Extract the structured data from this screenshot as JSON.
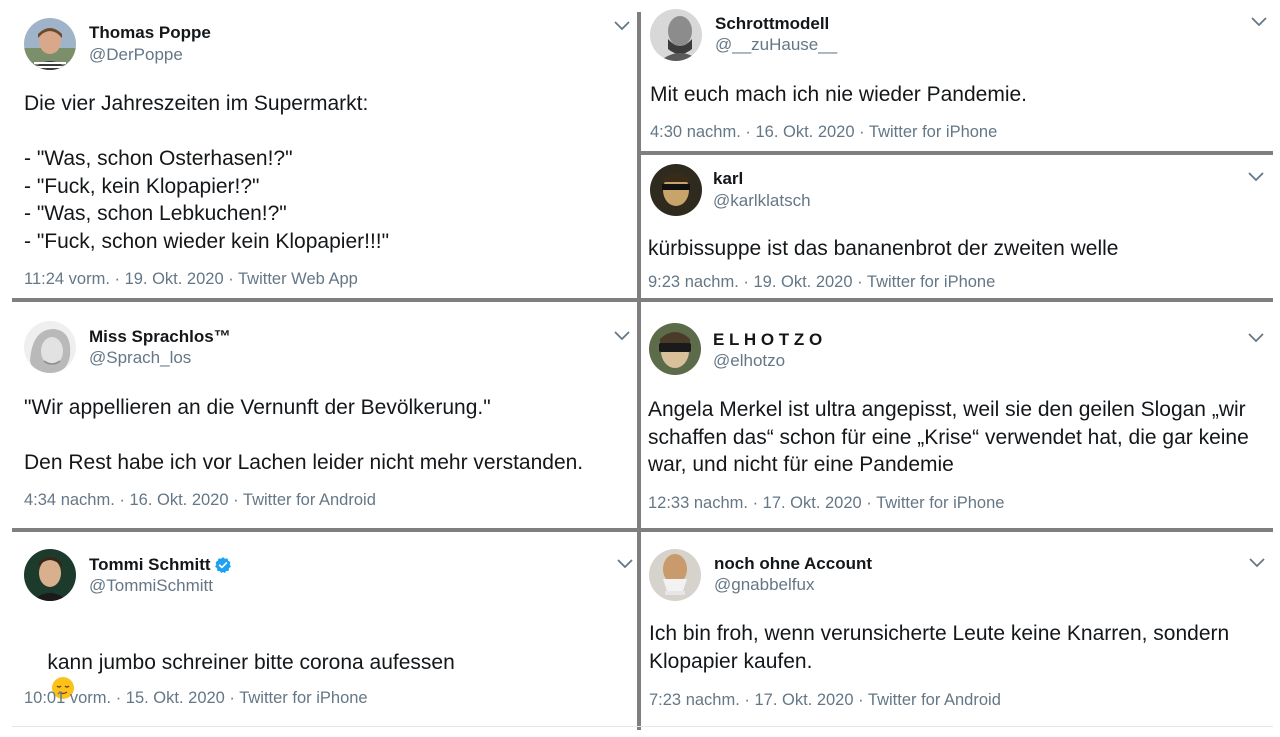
{
  "tweets": [
    {
      "name": "Thomas Poppe",
      "handle": "@DerPoppe",
      "text": "Die vier Jahreszeiten im Supermarkt:\n\n- \"Was, schon Osterhasen!?\"\n- \"Fuck, kein Klopapier!?\"\n- \"Was, schon Lebkuchen!?\"\n- \"Fuck, schon wieder kein Klopapier!!!\"",
      "meta": "11:24 vorm. · 19. Okt. 2020 · Twitter Web App"
    },
    {
      "name": "Schrottmodell",
      "handle": "@__zuHause__",
      "text": "Mit euch mach ich nie wieder Pandemie.",
      "meta": "4:30 nachm. · 16. Okt. 2020 · Twitter for iPhone"
    },
    {
      "name": "karl",
      "handle": "@karlklatsch",
      "text": "kürbissuppe ist das bananenbrot der zweiten welle",
      "meta": "9:23 nachm. · 19. Okt. 2020 · Twitter for iPhone"
    },
    {
      "name": "Miss Sprachlos™",
      "handle": "@Sprach_los",
      "text": "\"Wir appellieren an die Vernunft der Bevölkerung.\"\n\nDen Rest habe ich vor Lachen leider nicht mehr verstanden.",
      "meta": "4:34 nachm. · 16. Okt. 2020 · Twitter for Android"
    },
    {
      "name": "E L H O T Z O",
      "handle": "@elhotzo",
      "text": "Angela Merkel ist ultra angepisst, weil sie den geilen Slogan „wir\nschaffen das“ schon für eine „Krise“ verwendet hat, die gar keine\nwar, und nicht für eine Pandemie",
      "meta": "12:33 nachm. · 17. Okt. 2020 · Twitter for iPhone"
    },
    {
      "name": "Tommi Schmitt",
      "handle": "@TommiSchmitt",
      "text": "kann jumbo schreiner bitte corona aufessen",
      "meta": "10:01 vorm. · 15. Okt. 2020 · Twitter for iPhone",
      "emoji": "relieved-face-emoji"
    },
    {
      "name": "noch ohne Account",
      "handle": "@gnabbelfux",
      "text": "Ich bin froh, wenn verunsicherte Leute keine Knarren, sondern\nKlopapier kaufen.",
      "meta": "7:23 nachm. · 17. Okt. 2020 · Twitter for Android"
    }
  ],
  "icons": {
    "menu": "chevron-down-icon",
    "verified": "verified-badge-icon"
  },
  "colors": {
    "text": "#14171a",
    "secondary": "#657786",
    "verified": "#1da1f2",
    "divider": "#7f7f7f"
  }
}
